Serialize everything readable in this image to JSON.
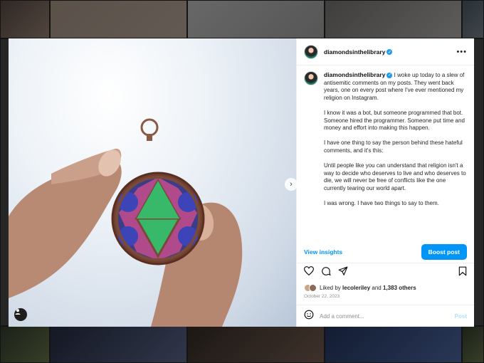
{
  "post": {
    "username": "diamondsinthelibrary",
    "more_label": "•••",
    "caption_paragraphs": [
      "I woke up today to a slew of antisemitic comments on my posts. They went back years, one on every post where I've ever mentioned my religion on Instagram.",
      "I know it was a bot, but someone programmed that bot. Someone hired the programmer. Someone put time and money and effort into making this happen.",
      "I have one thing to say the person behind these hateful comments, and it's this:",
      "Until people like you can understand that religion isn't a way to decide who deserves to live and who deserves to die, we will never be free of conflicts like the one currently tearing our world apart.",
      "I was wrong. I have two things to say to them."
    ],
    "view_insights": "View insights",
    "boost_post": "Boost post",
    "likes_prefix": "Liked by",
    "likes_user": "lecoleriley",
    "likes_and": "and",
    "likes_others": "1,383 others",
    "date": "October 22, 2023",
    "comment_placeholder": "Add a comment...",
    "post_label": "Post"
  },
  "icons": {
    "verified": "verified-badge-icon",
    "like": "heart-icon",
    "comment": "comment-icon",
    "share": "share-icon",
    "save": "bookmark-icon",
    "emoji": "emoji-icon",
    "user_tag": "user-tag-icon",
    "next": "chevron-right-icon"
  },
  "colors": {
    "accent": "#0095f6",
    "verified": "#1d9bf0"
  }
}
